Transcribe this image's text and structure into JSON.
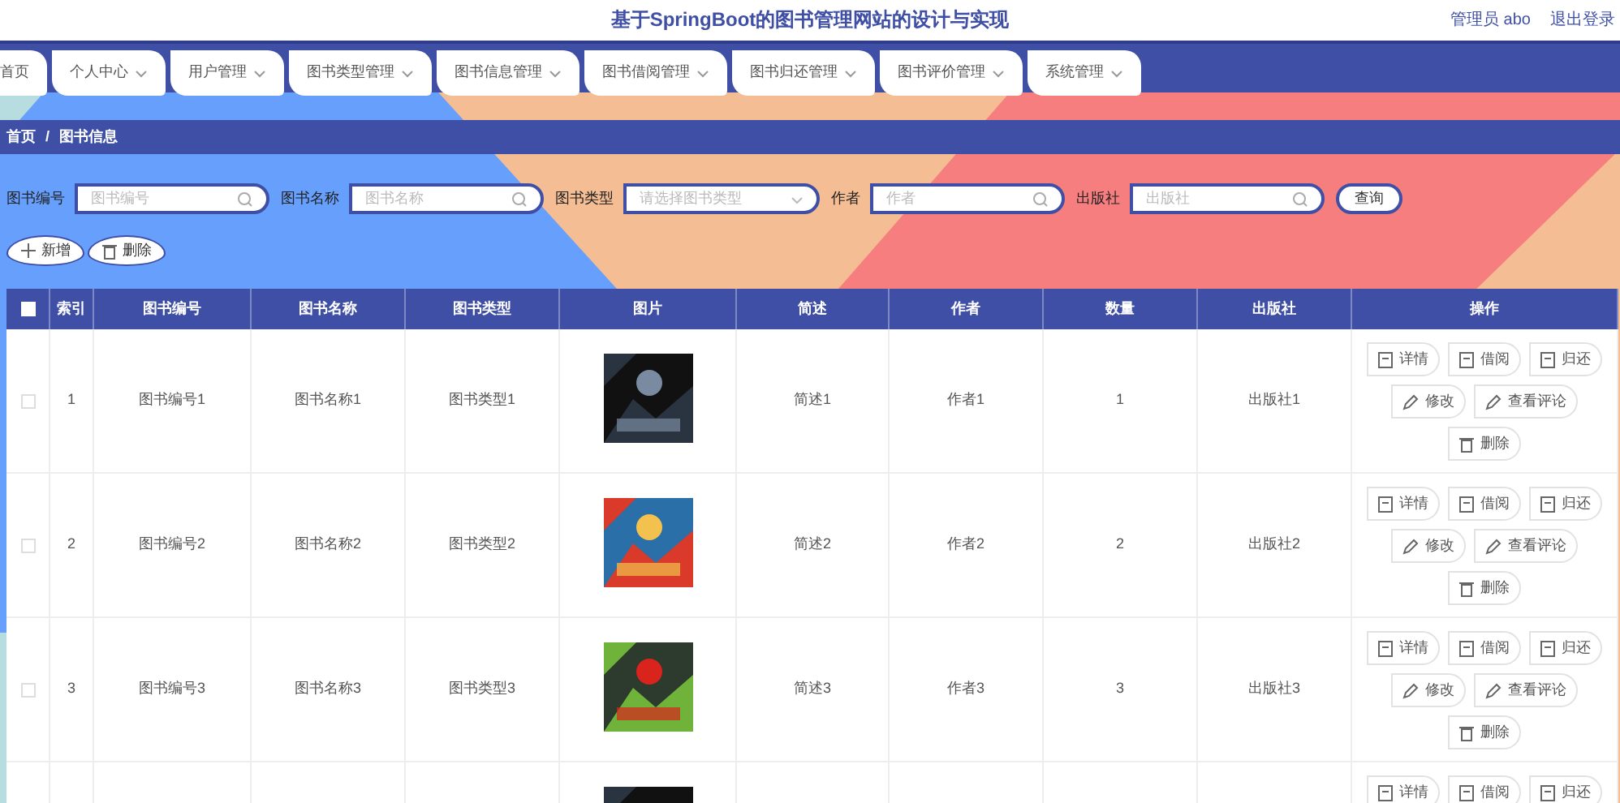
{
  "header": {
    "title": "基于SpringBoot的图书管理网站的设计与实现",
    "user": "管理员 abo",
    "logout": "退出登录"
  },
  "nav": [
    {
      "label": "首页",
      "dropdown": false,
      "selected": false
    },
    {
      "label": "个人中心",
      "dropdown": true,
      "selected": false
    },
    {
      "label": "用户管理",
      "dropdown": true,
      "selected": false
    },
    {
      "label": "图书类型管理",
      "dropdown": true,
      "selected": false
    },
    {
      "label": "图书信息管理",
      "dropdown": true,
      "selected": false
    },
    {
      "label": "图书借阅管理",
      "dropdown": true,
      "selected": false
    },
    {
      "label": "图书归还管理",
      "dropdown": true,
      "selected": false
    },
    {
      "label": "图书评价管理",
      "dropdown": true,
      "selected": false
    },
    {
      "label": "系统管理",
      "dropdown": true,
      "selected": false
    }
  ],
  "breadcrumb": [
    "首页",
    "图书信息"
  ],
  "breadcrumb_separator": "/",
  "filters": [
    {
      "kind": "text",
      "label": "图书编号",
      "placeholder": "图书编号"
    },
    {
      "kind": "text",
      "label": "图书名称",
      "placeholder": "图书名称"
    },
    {
      "kind": "select",
      "label": "图书类型",
      "placeholder": "请选择图书类型"
    },
    {
      "kind": "text",
      "label": "作者",
      "placeholder": "作者"
    },
    {
      "kind": "text",
      "label": "出版社",
      "placeholder": "出版社"
    }
  ],
  "search_button": "查询",
  "toolbar": [
    {
      "kind": "add",
      "label": "新增"
    },
    {
      "kind": "delete",
      "label": "删除"
    }
  ],
  "table": {
    "select_all": {
      "checked": false
    },
    "columns": [
      "索引",
      "图书编号",
      "图书名称",
      "图书类型",
      "图片",
      "简述",
      "作者",
      "数量",
      "出版社",
      "操作"
    ],
    "rows": [
      {
        "checked": false,
        "cells": [
          "1",
          "图书编号1",
          "图书名称1",
          "图书类型1",
          null,
          "简述1",
          "作者1",
          "1",
          "出版社1"
        ],
        "picture": {
          "kind": "picture"
        },
        "actions": [
          {
            "kind": "view",
            "label": "详情"
          },
          {
            "kind": "view",
            "label": "借阅"
          },
          {
            "kind": "view",
            "label": "归还"
          },
          {
            "kind": "edit",
            "label": "修改"
          },
          {
            "kind": "edit",
            "label": "查看评论"
          },
          {
            "kind": "delete",
            "label": "删除"
          }
        ]
      },
      {
        "checked": false,
        "cells": [
          "2",
          "图书编号2",
          "图书名称2",
          "图书类型2",
          null,
          "简述2",
          "作者2",
          "2",
          "出版社2"
        ],
        "picture": {
          "kind": "picture"
        },
        "actions": [
          {
            "kind": "view",
            "label": "详情"
          },
          {
            "kind": "view",
            "label": "借阅"
          },
          {
            "kind": "view",
            "label": "归还"
          },
          {
            "kind": "edit",
            "label": "修改"
          },
          {
            "kind": "edit",
            "label": "查看评论"
          },
          {
            "kind": "delete",
            "label": "删除"
          }
        ]
      },
      {
        "checked": false,
        "cells": [
          "3",
          "图书编号3",
          "图书名称3",
          "图书类型3",
          null,
          "简述3",
          "作者3",
          "3",
          "出版社3"
        ],
        "picture": {
          "kind": "picture"
        },
        "actions": [
          {
            "kind": "view",
            "label": "详情"
          },
          {
            "kind": "view",
            "label": "借阅"
          },
          {
            "kind": "view",
            "label": "归还"
          },
          {
            "kind": "edit",
            "label": "修改"
          },
          {
            "kind": "edit",
            "label": "查看评论"
          },
          {
            "kind": "delete",
            "label": "删除"
          }
        ]
      },
      {
        "picture": {
          "kind": "picture"
        },
        "actions": [
          {
            "kind": "view",
            "label": "详情"
          },
          {
            "kind": "view",
            "label": "借阅"
          },
          {
            "kind": "view",
            "label": "归还"
          }
        ]
      }
    ]
  }
}
